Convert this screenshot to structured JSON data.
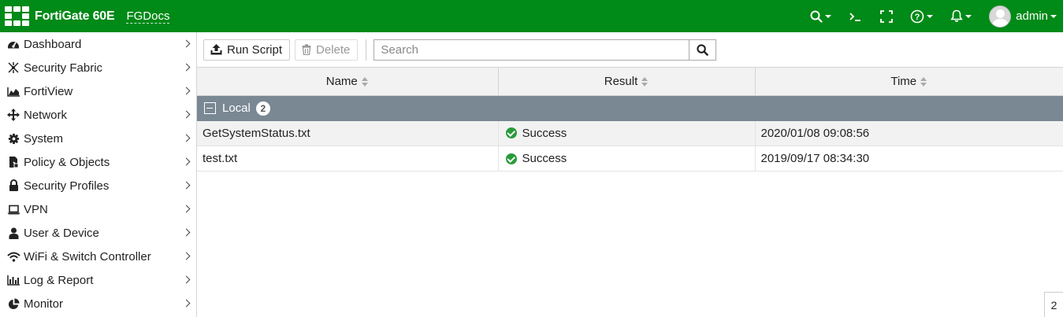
{
  "header": {
    "product": "FortiGate 60E",
    "hostname": "FGDocs",
    "user": "admin",
    "bg_color": "#008a17",
    "icons": [
      "search-icon",
      "cli-console-icon",
      "fullscreen-icon",
      "help-icon",
      "notification-bell-icon",
      "user-avatar-icon"
    ]
  },
  "sidebar": {
    "items": [
      {
        "label": "Dashboard",
        "icon": "dashboard-icon"
      },
      {
        "label": "Security Fabric",
        "icon": "security-fabric-icon"
      },
      {
        "label": "FortiView",
        "icon": "fortiview-icon"
      },
      {
        "label": "Network",
        "icon": "network-icon"
      },
      {
        "label": "System",
        "icon": "gear-icon"
      },
      {
        "label": "Policy & Objects",
        "icon": "policy-icon"
      },
      {
        "label": "Security Profiles",
        "icon": "lock-icon"
      },
      {
        "label": "VPN",
        "icon": "laptop-icon"
      },
      {
        "label": "User & Device",
        "icon": "user-icon"
      },
      {
        "label": "WiFi & Switch Controller",
        "icon": "wifi-icon"
      },
      {
        "label": "Log & Report",
        "icon": "bar-chart-icon"
      },
      {
        "label": "Monitor",
        "icon": "pie-chart-icon"
      }
    ]
  },
  "toolbar": {
    "run_script_label": "Run Script",
    "delete_label": "Delete",
    "search_placeholder": "Search"
  },
  "table": {
    "columns": [
      "Name",
      "Result",
      "Time"
    ],
    "group": {
      "label": "Local",
      "count": "2"
    },
    "rows": [
      {
        "name": "GetSystemStatus.txt",
        "result": "Success",
        "time": "2020/01/08 09:08:56"
      },
      {
        "name": "test.txt",
        "result": "Success",
        "time": "2019/09/17 08:34:30"
      }
    ]
  },
  "footer": {
    "total": "2"
  }
}
